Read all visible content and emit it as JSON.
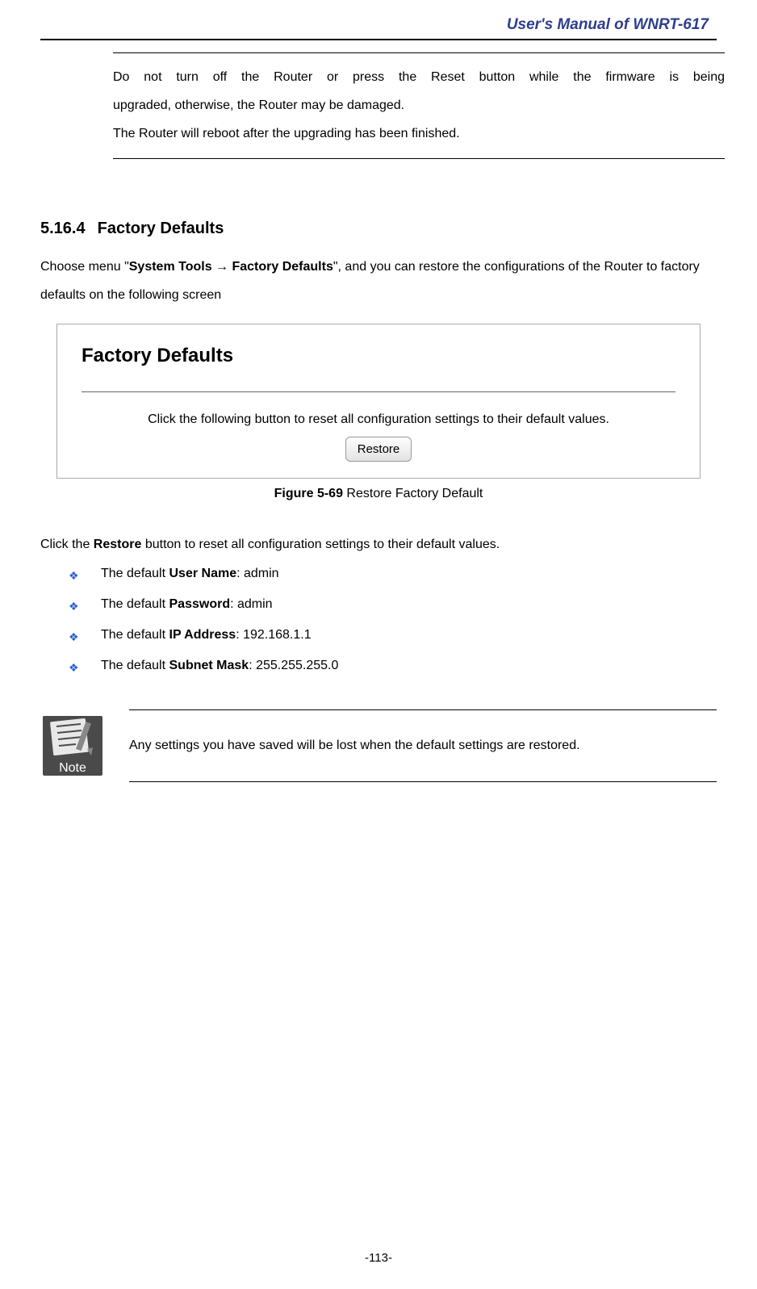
{
  "header": {
    "manual_title": "User's Manual of WNRT-617"
  },
  "warning": {
    "line1": "Do not turn off the Router or press the Reset button while the firmware is being",
    "line2": "upgraded, otherwise, the Router may be damaged.",
    "line3": "The Router will reboot after the upgrading has been finished."
  },
  "section": {
    "number": "5.16.4",
    "title": "Factory Defaults"
  },
  "intro": {
    "prefix": "Choose menu \"",
    "menu_path": "System Tools → Factory Defaults",
    "suffix": "\", and you can restore the configurations of the Router to factory defaults on the following screen"
  },
  "figure": {
    "title": "Factory Defaults",
    "description": "Click the following button to reset all configuration settings to their default values.",
    "button_label": "Restore",
    "caption_bold": "Figure 5-69",
    "caption_rest": " Restore Factory Default"
  },
  "after_figure": {
    "prefix": "Click the ",
    "bold": "Restore",
    "suffix": " button to reset all configuration settings to their default values."
  },
  "defaults": [
    {
      "prefix": "The default ",
      "bold": "User Name",
      "suffix": ": admin"
    },
    {
      "prefix": "The default ",
      "bold": "Password",
      "suffix": ": admin"
    },
    {
      "prefix": "The default ",
      "bold": "IP Address",
      "suffix": ": 192.168.1.1"
    },
    {
      "prefix": "The default ",
      "bold": "Subnet Mask",
      "suffix": ": 255.255.255.0"
    }
  ],
  "note": {
    "label": "Note",
    "text": "Any settings you have saved will be lost when the default settings are restored."
  },
  "page_number": "-113-"
}
